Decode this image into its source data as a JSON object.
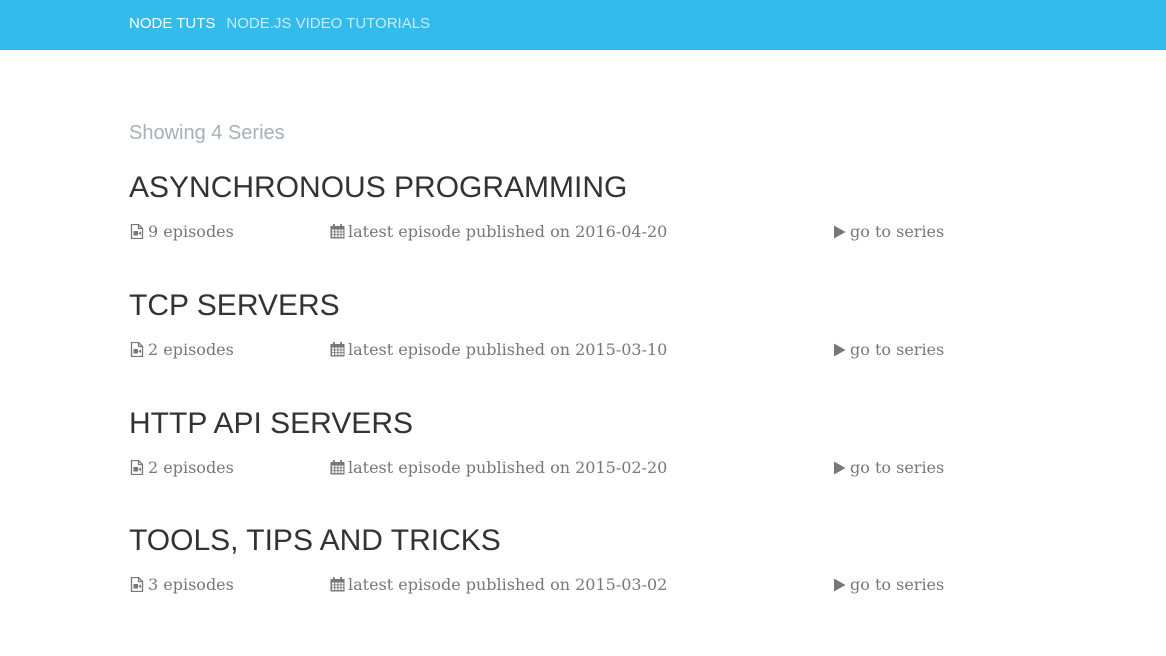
{
  "navbar": {
    "brand": "NODE TUTS",
    "subtitle": "NODE.JS VIDEO TUTORIALS",
    "background_color": "#33bbec"
  },
  "main": {
    "count_label": "Showing 4 Series",
    "series": [
      {
        "title": "ASYNCHRONOUS PROGRAMMING",
        "episodes": "9 episodes",
        "published": "latest episode published on 2016-04-20",
        "link": "go to series"
      },
      {
        "title": "TCP SERVERS",
        "episodes": "2 episodes",
        "published": "latest episode published on 2015-03-10",
        "link": "go to series"
      },
      {
        "title": "HTTP API SERVERS",
        "episodes": "2 episodes",
        "published": "latest episode published on 2015-02-20",
        "link": "go to series"
      },
      {
        "title": "TOOLS, TIPS AND TRICKS",
        "episodes": "3 episodes",
        "published": "latest episode published on 2015-03-02",
        "link": "go to series"
      }
    ]
  },
  "icons": {
    "episodes": "video-file-icon",
    "published": "calendar-icon",
    "link": "play-icon"
  }
}
